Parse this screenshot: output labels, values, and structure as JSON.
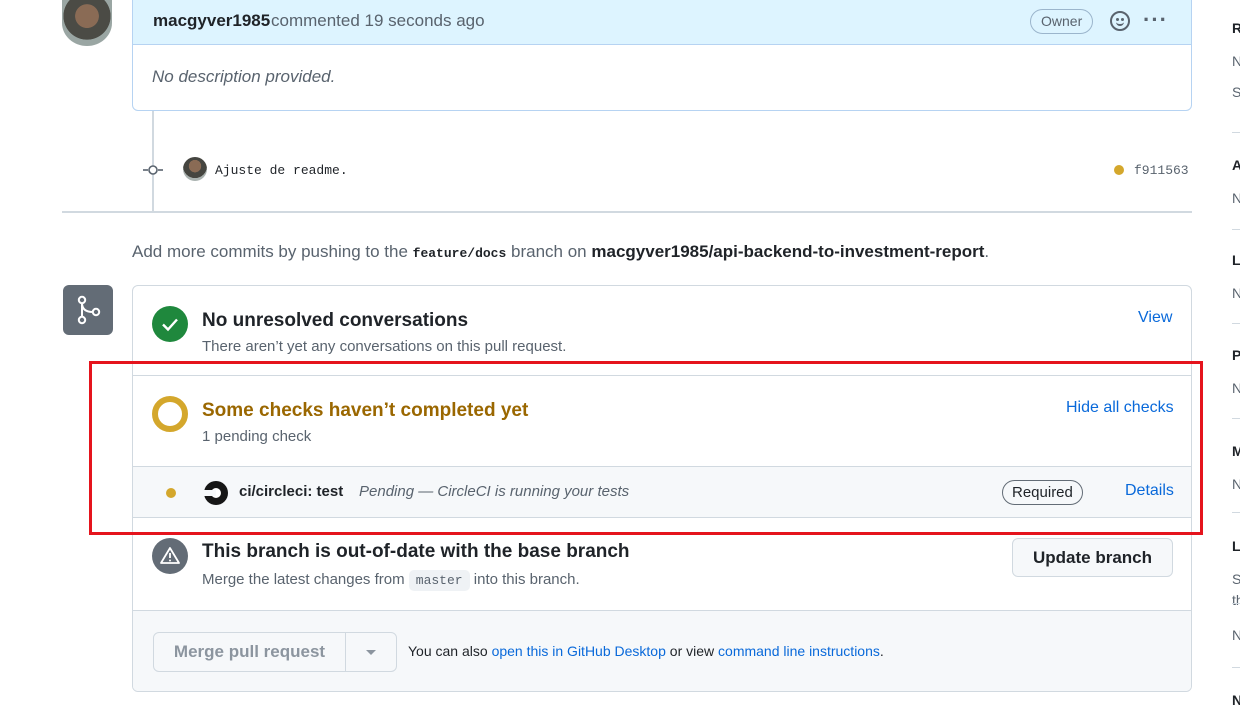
{
  "comment": {
    "author": "macgyver1985",
    "time_text": "commented 19 seconds ago",
    "badge": "Owner",
    "body": "No description provided."
  },
  "commit": {
    "message": "Ajuste de readme.",
    "sha": "f911563"
  },
  "push_note": {
    "prefix": "Add more commits by pushing to the",
    "branch": "feature/docs",
    "middle": "branch on",
    "repo": "macgyver1985/api-backend-to-investment-report",
    "suffix": "."
  },
  "conversations": {
    "title": "No unresolved conversations",
    "subtitle": "There aren’t yet any conversations on this pull request.",
    "link": "View"
  },
  "checks": {
    "title": "Some checks haven’t completed yet",
    "subtitle": "1 pending check",
    "link": "Hide all checks",
    "items": [
      {
        "name": "ci/circleci: test",
        "description": "Pending — CircleCI is running your tests",
        "badge": "Required",
        "link": "Details"
      }
    ]
  },
  "branch_status": {
    "title": "This branch is out-of-date with the base branch",
    "subtitle_prefix": "Merge the latest changes from",
    "base_branch": "master",
    "subtitle_suffix": "into this branch.",
    "button": "Update branch"
  },
  "merge": {
    "button": "Merge pull request",
    "footer_prefix": "You can also",
    "footer_link1": "open this in GitHub Desktop",
    "footer_middle": "or view",
    "footer_link2": "command line instructions",
    "footer_suffix": "."
  },
  "sidebar_fragments": [
    "R",
    "N",
    "S",
    "A",
    "N",
    "L",
    "N",
    "P",
    "N",
    "M",
    "N",
    "L",
    "S",
    "th",
    "N",
    "N"
  ],
  "colors": {
    "accent": "#0969da",
    "success": "#1f883d",
    "pending": "#d4a72c",
    "highlight": "#e5141d"
  },
  "icons": {
    "merge_status": "git-merge-icon",
    "commit": "git-commit-icon",
    "success": "check-circle-icon",
    "pending": "pending-ring-icon",
    "warning": "alert-icon",
    "reaction": "smiley-icon",
    "menu": "kebab-menu-icon",
    "ci": "circleci-logo-icon"
  }
}
